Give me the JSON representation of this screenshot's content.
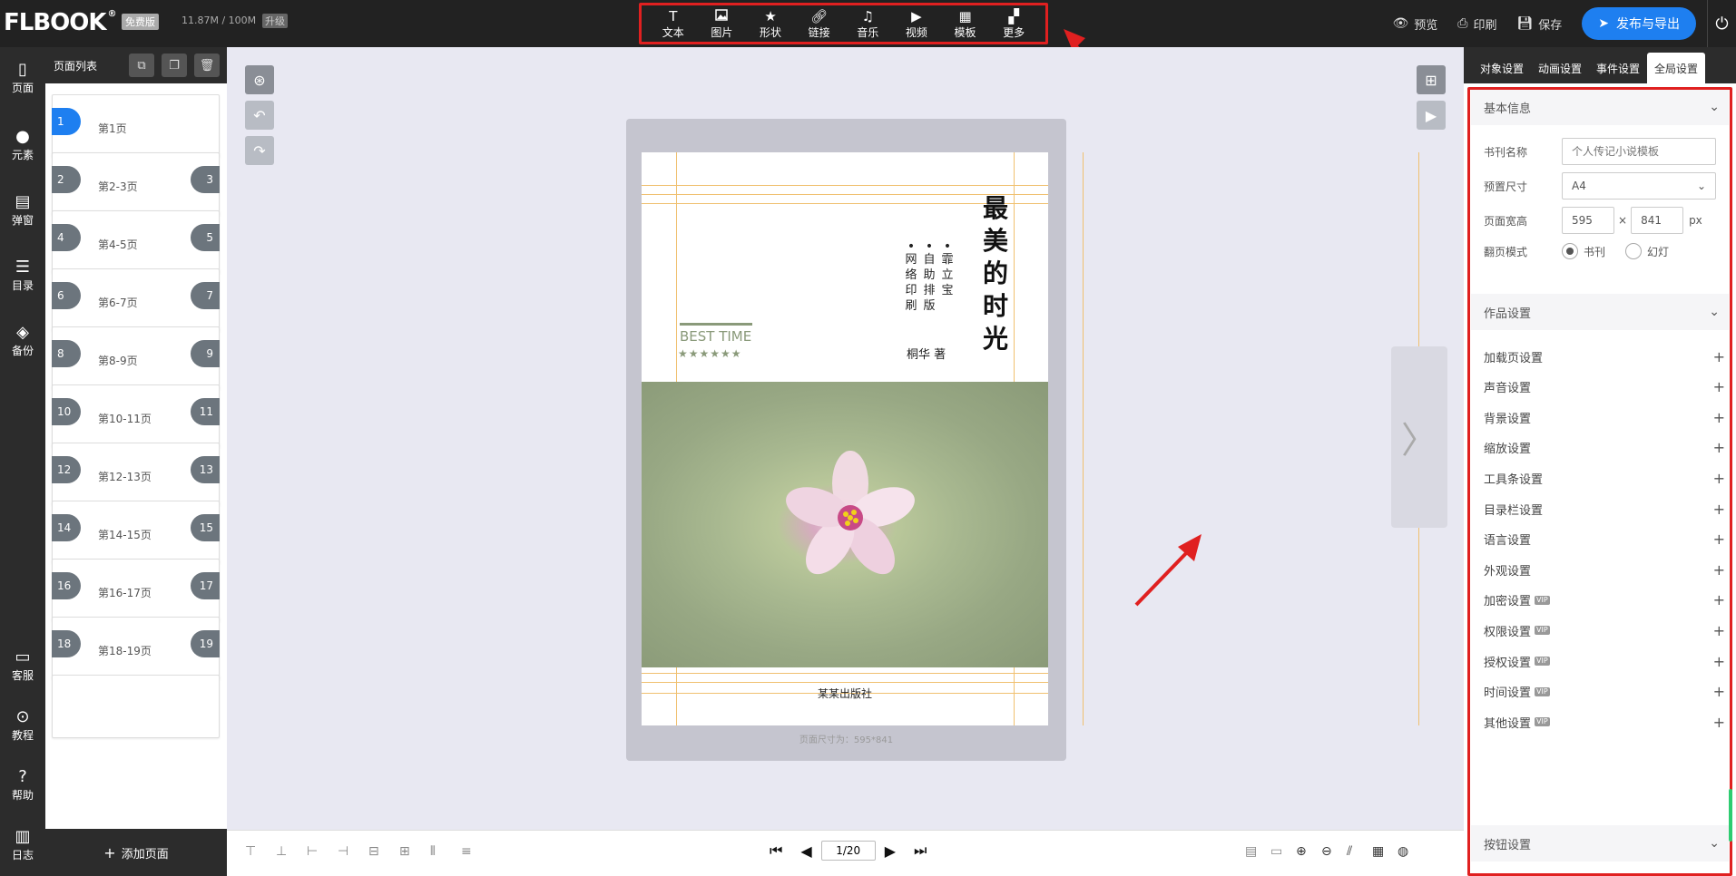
{
  "app": {
    "logo_text": "FLBOOK",
    "logo_mark": "®",
    "plan_badge": "免费版",
    "storage": "11.87M / 100M",
    "upgrade": "升级"
  },
  "toolbar": {
    "items": [
      {
        "label": "文本",
        "icon": "text-icon"
      },
      {
        "label": "图片",
        "icon": "image-icon"
      },
      {
        "label": "形状",
        "icon": "star-icon"
      },
      {
        "label": "链接",
        "icon": "link-icon"
      },
      {
        "label": "音乐",
        "icon": "music-icon"
      },
      {
        "label": "视频",
        "icon": "video-icon"
      },
      {
        "label": "模板",
        "icon": "template-icon"
      },
      {
        "label": "更多",
        "icon": "more-icon"
      }
    ]
  },
  "header_right": {
    "preview": "预览",
    "print": "印刷",
    "save": "保存",
    "publish": "发布与导出"
  },
  "rail": {
    "items": [
      {
        "label": "页面",
        "icon": "page-icon"
      },
      {
        "label": "元素",
        "icon": "elements-icon"
      },
      {
        "label": "弹窗",
        "icon": "popup-icon"
      },
      {
        "label": "目录",
        "icon": "toc-icon"
      },
      {
        "label": "备份",
        "icon": "backup-icon"
      },
      {
        "label": "客服",
        "icon": "chat-icon"
      },
      {
        "label": "教程",
        "icon": "play-icon"
      },
      {
        "label": "帮助",
        "icon": "help-icon"
      },
      {
        "label": "日志",
        "icon": "log-icon"
      }
    ]
  },
  "page_list": {
    "title": "页面列表",
    "items": [
      {
        "left": "1",
        "right": "",
        "label": "第1页",
        "active": true
      },
      {
        "left": "2",
        "right": "3",
        "label": "第2-3页"
      },
      {
        "left": "4",
        "right": "5",
        "label": "第4-5页"
      },
      {
        "left": "6",
        "right": "7",
        "label": "第6-7页"
      },
      {
        "left": "8",
        "right": "9",
        "label": "第8-9页"
      },
      {
        "left": "10",
        "right": "11",
        "label": "第10-11页"
      },
      {
        "left": "12",
        "right": "13",
        "label": "第12-13页"
      },
      {
        "left": "14",
        "right": "15",
        "label": "第14-15页"
      },
      {
        "left": "16",
        "right": "17",
        "label": "第16-17页"
      },
      {
        "left": "18",
        "right": "19",
        "label": "第18-19页"
      }
    ],
    "add_label": "添加页面"
  },
  "cover": {
    "title": "最美的时光",
    "subtitle_cols": [
      "霏立宝",
      "自助排版",
      "网络印刷"
    ],
    "author": "桐华 著",
    "best_time": "BEST TIME",
    "stars": "★★★★★★",
    "publisher": "某某出版社"
  },
  "canvas": {
    "page_size": "页面尺寸为：595*841"
  },
  "pager": {
    "current": "1/20"
  },
  "right_panel": {
    "tabs": [
      "对象设置",
      "动画设置",
      "事件设置",
      "全局设置"
    ],
    "active_tab": 3,
    "basic_info": {
      "title": "基本信息",
      "name_label": "书刊名称",
      "name_placeholder": "个人传记小说模板",
      "size_label": "预置尺寸",
      "size_value": "A4",
      "wh_label": "页面宽高",
      "width": "595",
      "x_sep": "×",
      "height": "841",
      "unit": "px",
      "flip_label": "翻页模式",
      "flip_book": "书刊",
      "flip_slide": "幻灯"
    },
    "work_settings": {
      "title": "作品设置",
      "items": [
        {
          "label": "加载页设置",
          "vip": false
        },
        {
          "label": "声音设置",
          "vip": false
        },
        {
          "label": "背景设置",
          "vip": false
        },
        {
          "label": "缩放设置",
          "vip": false
        },
        {
          "label": "工具条设置",
          "vip": false
        },
        {
          "label": "目录栏设置",
          "vip": false
        },
        {
          "label": "语言设置",
          "vip": false
        },
        {
          "label": "外观设置",
          "vip": false
        },
        {
          "label": "加密设置",
          "vip": true
        },
        {
          "label": "权限设置",
          "vip": true
        },
        {
          "label": "授权设置",
          "vip": true
        },
        {
          "label": "时间设置",
          "vip": true
        },
        {
          "label": "其他设置",
          "vip": true
        }
      ],
      "vip_text": "VIP"
    },
    "button_settings": {
      "title": "按钮设置"
    }
  }
}
